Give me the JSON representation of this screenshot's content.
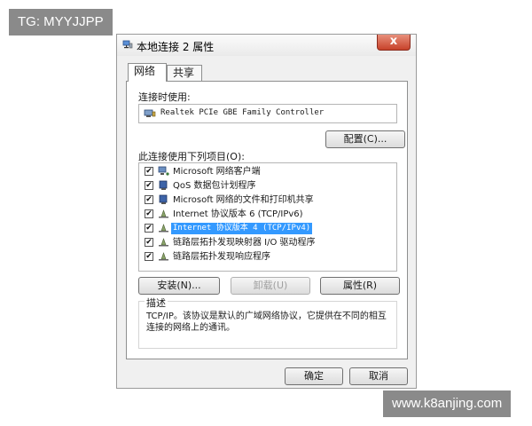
{
  "watermarks": {
    "top_left": "TG: MYYJJPP",
    "bottom_right": "www.k8anjing.com"
  },
  "window": {
    "title": "本地连接 2 属性",
    "close_glyph": "x"
  },
  "tabs": [
    {
      "label": "网络",
      "active": true
    },
    {
      "label": "共享",
      "active": false
    }
  ],
  "connection": {
    "label": "连接时使用:",
    "adapter": "Realtek PCIe GBE Family Controller",
    "configure_label": "配置(C)..."
  },
  "items": {
    "label": "此连接使用下列项目(O):",
    "list": [
      {
        "text": "Microsoft 网络客户端",
        "checked": true,
        "icon": "network-client-icon",
        "selected": false
      },
      {
        "text": "QoS 数据包计划程序",
        "checked": true,
        "icon": "qos-icon",
        "selected": false
      },
      {
        "text": "Microsoft 网络的文件和打印机共享",
        "checked": true,
        "icon": "file-printer-sharing-icon",
        "selected": false
      },
      {
        "text": "Internet 协议版本 6 (TCP/IPv6)",
        "checked": true,
        "icon": "protocol-icon",
        "selected": false
      },
      {
        "text": "Internet 协议版本 4 (TCP/IPv4)",
        "checked": true,
        "icon": "protocol-icon",
        "selected": true
      },
      {
        "text": "链路层拓扑发现映射器 I/O 驱动程序",
        "checked": true,
        "icon": "protocol-icon",
        "selected": false
      },
      {
        "text": "链路层拓扑发现响应程序",
        "checked": true,
        "icon": "protocol-icon",
        "selected": false
      }
    ],
    "check_glyph": "✔"
  },
  "actions": {
    "install_label": "安装(N)...",
    "uninstall_label": "卸载(U)",
    "properties_label": "属性(R)"
  },
  "description": {
    "title": "描述",
    "text": "TCP/IP。该协议是默认的广域网络协议，它提供在不同的相互连接的网络上的通讯。"
  },
  "footer": {
    "ok_label": "确定",
    "cancel_label": "取消"
  },
  "colors": {
    "selection": "#3399ff",
    "close_button": "#c7422a"
  }
}
